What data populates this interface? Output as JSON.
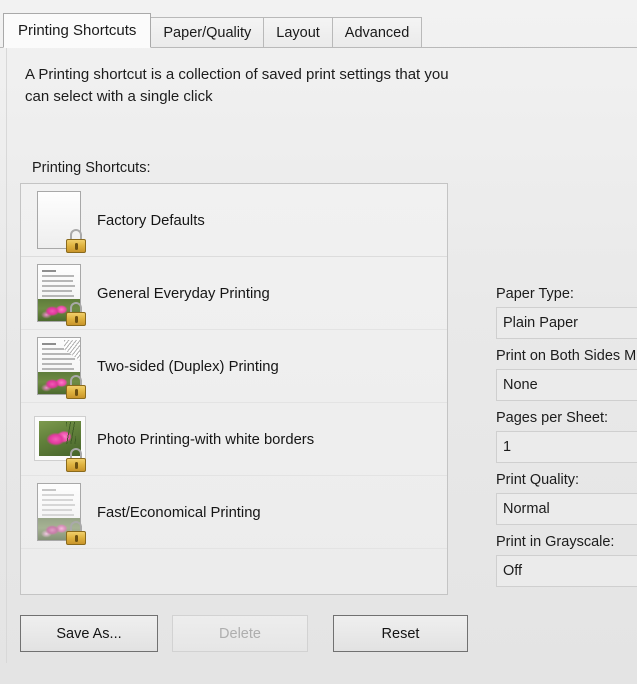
{
  "tabs": [
    {
      "label": "Printing Shortcuts",
      "active": true
    },
    {
      "label": "Paper/Quality",
      "active": false
    },
    {
      "label": "Layout",
      "active": false
    },
    {
      "label": "Advanced",
      "active": false
    }
  ],
  "intro": "A Printing shortcut is a collection of saved print settings that you can select with a single click",
  "list": {
    "label": "Printing Shortcuts:",
    "items": [
      {
        "label": "Factory Defaults",
        "icon": "blank-page-locked-icon",
        "locked": true
      },
      {
        "label": "General Everyday Printing",
        "icon": "document-photo-locked-icon",
        "locked": true
      },
      {
        "label": "Two-sided (Duplex) Printing",
        "icon": "duplex-document-locked-icon",
        "locked": true
      },
      {
        "label": "Photo Printing-with white borders",
        "icon": "bordered-photo-locked-icon",
        "locked": true
      },
      {
        "label": "Fast/Economical Printing",
        "icon": "draft-document-locked-icon",
        "locked": true
      }
    ]
  },
  "buttons": {
    "save_as": "Save As...",
    "delete": "Delete",
    "delete_disabled": true,
    "reset": "Reset"
  },
  "settings": [
    {
      "label": "Paper Type:",
      "value": "Plain Paper"
    },
    {
      "label": "Print on Both Sides M",
      "value": "None"
    },
    {
      "label": "Pages per Sheet:",
      "value": "1"
    },
    {
      "label": "Print Quality:",
      "value": "Normal"
    },
    {
      "label": "Print in Grayscale:",
      "value": "Off"
    }
  ],
  "colors": {
    "panel_bg": "#ececec",
    "tab_border": "#b9b9b9",
    "active_tab_bg": "#fbfbfb",
    "lock_gold": "#dfb33f",
    "field_bg": "#ebebeb",
    "text": "#1c1c1c",
    "disabled_text": "#aeaeae"
  }
}
